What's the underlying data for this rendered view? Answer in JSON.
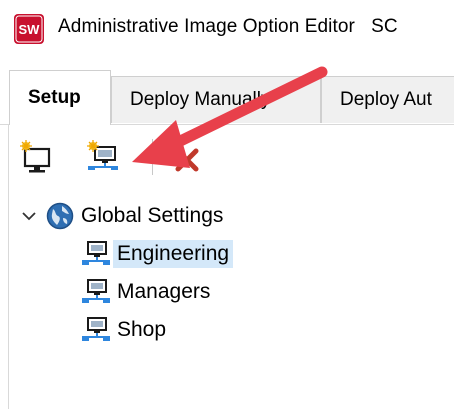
{
  "window": {
    "logo_text": "SW",
    "title": "Administrative Image Option Editor",
    "title_suffix": "SC"
  },
  "tabs": [
    {
      "label": "Setup",
      "active": true
    },
    {
      "label": "Deploy Manually",
      "active": false
    },
    {
      "label": "Deploy Aut",
      "active": false
    }
  ],
  "toolbar": {
    "buttons": [
      {
        "icon": "new-computer-icon"
      },
      {
        "icon": "new-network-group-icon"
      },
      {
        "icon": "delete-icon"
      }
    ]
  },
  "tree": {
    "root": {
      "label": "Global Settings",
      "icon": "globe-icon",
      "expanded": true
    },
    "children": [
      {
        "label": "Engineering",
        "icon": "network-group-icon",
        "selected": true
      },
      {
        "label": "Managers",
        "icon": "network-group-icon",
        "selected": false
      },
      {
        "label": "Shop",
        "icon": "network-group-icon",
        "selected": false
      }
    ]
  },
  "colors": {
    "logo_red": "#c8102e",
    "selection": "#d4e8f9",
    "arrow": "#e8404b",
    "delete_red": "#c0392b"
  }
}
